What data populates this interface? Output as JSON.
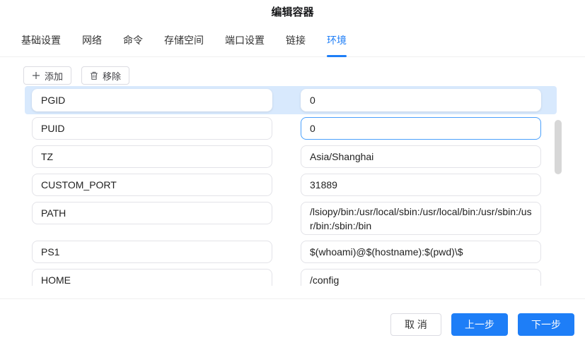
{
  "dialog": {
    "title": "编辑容器"
  },
  "tabs": [
    {
      "id": "basic",
      "label": "基础设置",
      "active": false
    },
    {
      "id": "network",
      "label": "网络",
      "active": false
    },
    {
      "id": "command",
      "label": "命令",
      "active": false
    },
    {
      "id": "storage",
      "label": "存储空间",
      "active": false
    },
    {
      "id": "ports",
      "label": "端口设置",
      "active": false
    },
    {
      "id": "links",
      "label": "链接",
      "active": false
    },
    {
      "id": "env",
      "label": "环境",
      "active": true
    }
  ],
  "toolbar": {
    "add_label": "添加",
    "remove_label": "移除"
  },
  "env_rows": [
    {
      "key": "PGID",
      "value": "0",
      "selected": true
    },
    {
      "key": "PUID",
      "value": "0",
      "value_focused": true
    },
    {
      "key": "TZ",
      "value": "Asia/Shanghai"
    },
    {
      "key": "CUSTOM_PORT",
      "value": "31889"
    },
    {
      "key": "PATH",
      "value": "/lsiopy/bin:/usr/local/sbin:/usr/local/bin:/usr/sbin:/usr/bin:/sbin:/bin",
      "multiline": true
    },
    {
      "key": "PS1",
      "value": "$(whoami)@$(hostname):$(pwd)\\$"
    },
    {
      "key": "HOME",
      "value": "/config",
      "clipped": true
    }
  ],
  "footer": {
    "cancel_label": "取 消",
    "prev_label": "上一步",
    "next_label": "下一步"
  },
  "colors": {
    "primary": "#1e7ef7",
    "focus_border": "#4aa0fc",
    "row_highlight": "#d8e9fd",
    "input_border": "#e3e3e8",
    "divider": "#efefef",
    "scrollbar_thumb": "#d7d7d7"
  }
}
